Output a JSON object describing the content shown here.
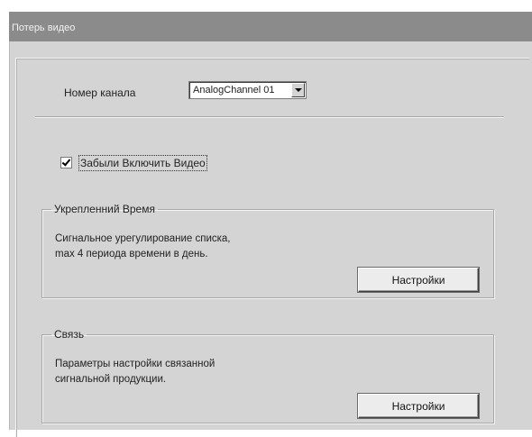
{
  "window": {
    "title": "Потерь видео"
  },
  "channel": {
    "label": "Номер канала",
    "selected": "AnalogChannel 01"
  },
  "enable_video": {
    "label": "Забыли Включить Видео",
    "checked": true
  },
  "schedule_group": {
    "legend": "Укрепленний Время",
    "description": "Сигнальное урегулирование списка,\nmax 4 периода времени в день.",
    "button_label": "Настройки"
  },
  "link_group": {
    "legend": "Связь",
    "description": "Параметры настройки связанной\nсигнальной продукции.",
    "button_label": "Настройки"
  }
}
